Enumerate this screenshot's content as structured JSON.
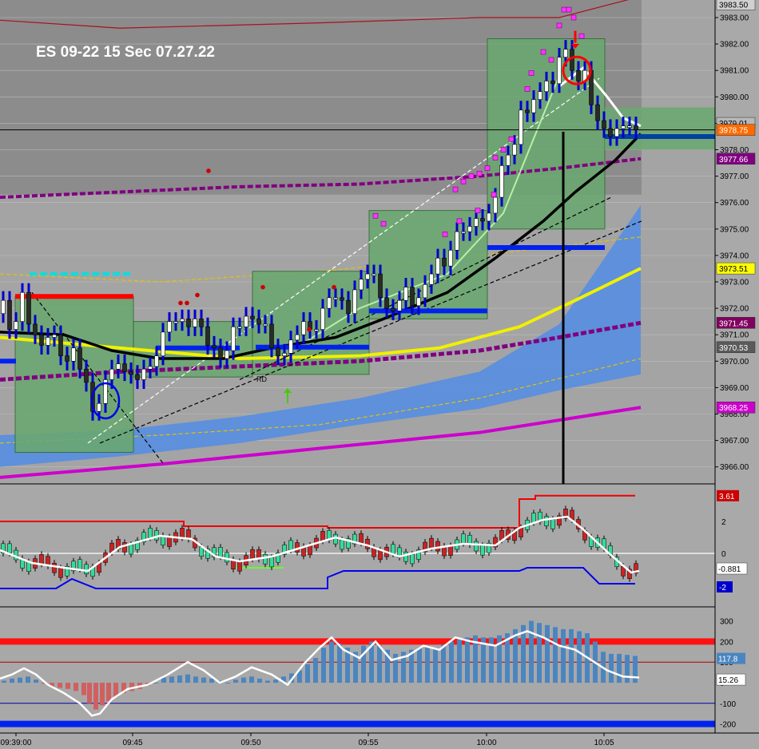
{
  "chart_title": "ES  09-22  15 Sec  07.27.22",
  "annotation_label": "RD",
  "chart_data": [
    {
      "type": "candlestick",
      "title": "ES  09-22  15 Sec  07.27.22",
      "ylim": [
        3965.5,
        3983.7
      ],
      "y_ticks": [
        "3966.00",
        "3967.00",
        "3968.00",
        "3969.00",
        "3970.00",
        "3971.00",
        "3972.00",
        "3973.00",
        "3974.00",
        "3975.00",
        "3976.00",
        "3977.00",
        "3978.00",
        "3979.00",
        "3980.00",
        "3981.00",
        "3982.00",
        "3983.00"
      ],
      "price_tags": [
        {
          "label": "3983.50",
          "value": 3983.5,
          "color": "#d0d0d0",
          "text_color": "#000000"
        },
        {
          "label": "3979.01",
          "value": 3979.01,
          "color": "#b8b8b8",
          "text_color": "#000000"
        },
        {
          "label": "3978.75",
          "value": 3978.75,
          "color": "#ff6a00",
          "text_color": "#ffffff"
        },
        {
          "label": "3977.66",
          "value": 3977.66,
          "color": "#800080",
          "text_color": "#ffffff"
        },
        {
          "label": "3973.51",
          "value": 3973.51,
          "color": "#ffff00",
          "text_color": "#000000"
        },
        {
          "label": "3971.45",
          "value": 3971.45,
          "color": "#800060",
          "text_color": "#ffffff"
        },
        {
          "label": "3970.53",
          "value": 3970.53,
          "color": "#5a5a5a",
          "text_color": "#ffffff"
        },
        {
          "label": "3968.25",
          "value": 3968.25,
          "color": "#cc00cc",
          "text_color": "#ffffff"
        }
      ],
      "close_path": [
        [
          0,
          3971.8
        ],
        [
          8,
          3972.3
        ],
        [
          16,
          3971.2
        ],
        [
          24,
          3971.5
        ],
        [
          32,
          3972.6
        ],
        [
          40,
          3971.4
        ],
        [
          48,
          3971.0
        ],
        [
          56,
          3970.6
        ],
        [
          64,
          3970.9
        ],
        [
          72,
          3971.0
        ],
        [
          80,
          3970.2
        ],
        [
          88,
          3970.0
        ],
        [
          96,
          3970.5
        ],
        [
          104,
          3969.7
        ],
        [
          112,
          3969.2
        ],
        [
          120,
          3968.1
        ],
        [
          128,
          3968.4
        ],
        [
          136,
          3969.3
        ],
        [
          144,
          3969.7
        ],
        [
          152,
          3969.9
        ],
        [
          160,
          3969.6
        ],
        [
          168,
          3969.5
        ],
        [
          176,
          3969.3
        ],
        [
          184,
          3969.7
        ],
        [
          192,
          3969.8
        ],
        [
          200,
          3970.2
        ],
        [
          208,
          3971.1
        ],
        [
          216,
          3971.5
        ],
        [
          224,
          3971.5
        ],
        [
          232,
          3971.6
        ],
        [
          240,
          3971.3
        ],
        [
          248,
          3971.6
        ],
        [
          256,
          3971.3
        ],
        [
          264,
          3970.6
        ],
        [
          272,
          3970.5
        ],
        [
          280,
          3970.1
        ],
        [
          288,
          3970.4
        ],
        [
          296,
          3971.3
        ],
        [
          304,
          3971.3
        ],
        [
          312,
          3971.7
        ],
        [
          320,
          3971.6
        ],
        [
          328,
          3971.4
        ],
        [
          336,
          3971.4
        ],
        [
          344,
          3970.5
        ],
        [
          352,
          3970.2
        ],
        [
          360,
          3970.3
        ],
        [
          368,
          3970.8
        ],
        [
          376,
          3971.0
        ],
        [
          384,
          3971.5
        ],
        [
          392,
          3971.2
        ],
        [
          400,
          3971.2
        ],
        [
          408,
          3972.0
        ],
        [
          416,
          3972.4
        ],
        [
          424,
          3972.4
        ],
        [
          432,
          3972.3
        ],
        [
          440,
          3971.8
        ],
        [
          448,
          3972.7
        ],
        [
          456,
          3973.1
        ],
        [
          464,
          3973.3
        ],
        [
          472,
          3973.3
        ],
        [
          480,
          3972.4
        ],
        [
          488,
          3972.0
        ],
        [
          496,
          3971.9
        ],
        [
          504,
          3972.3
        ],
        [
          512,
          3972.8
        ],
        [
          520,
          3972.1
        ],
        [
          528,
          3972.4
        ],
        [
          536,
          3972.9
        ],
        [
          544,
          3973.3
        ],
        [
          552,
          3973.9
        ],
        [
          560,
          3973.6
        ],
        [
          568,
          3974.2
        ],
        [
          576,
          3974.9
        ],
        [
          584,
          3974.9
        ],
        [
          592,
          3975.1
        ],
        [
          600,
          3975.4
        ],
        [
          608,
          3975.3
        ],
        [
          616,
          3975.6
        ],
        [
          624,
          3976.2
        ],
        [
          632,
          3977.4
        ],
        [
          640,
          3977.8
        ],
        [
          648,
          3978.2
        ],
        [
          656,
          3979.5
        ],
        [
          664,
          3979.4
        ],
        [
          672,
          3979.9
        ],
        [
          680,
          3980.2
        ],
        [
          688,
          3980.6
        ],
        [
          696,
          3980.5
        ],
        [
          704,
          3981.5
        ],
        [
          712,
          3981.8
        ],
        [
          720,
          3981.0
        ],
        [
          728,
          3980.6
        ],
        [
          736,
          3981.0
        ],
        [
          744,
          3979.7
        ],
        [
          752,
          3979.1
        ],
        [
          760,
          3978.8
        ],
        [
          768,
          3978.5
        ],
        [
          776,
          3978.8
        ],
        [
          784,
          3978.9
        ],
        [
          792,
          3978.9
        ],
        [
          800,
          3978.75
        ]
      ],
      "green_zones": [
        {
          "x0": 19,
          "x1": 167,
          "top": 3972.45,
          "bottom": 3966.55
        },
        {
          "x0": 167,
          "x1": 316,
          "top": 3971.5,
          "bottom": 3969.4
        },
        {
          "x0": 316,
          "x1": 462,
          "top": 3973.4,
          "bottom": 3969.5
        },
        {
          "x0": 462,
          "x1": 610,
          "top": 3975.7,
          "bottom": 3971.6
        },
        {
          "x0": 610,
          "x1": 757,
          "top": 3982.2,
          "bottom": 3975.0
        }
      ],
      "time_labels": [
        "09:39:00",
        "09:45",
        "09:50",
        "09:55",
        "10:00",
        "10:05"
      ]
    },
    {
      "type": "line",
      "name_values": [
        "3.61",
        "2",
        "0",
        "-2",
        "-0.881"
      ],
      "ylim": [
        -2.7,
        4.5
      ],
      "series": [
        {
          "points": [
            [
              0,
              0.2
            ],
            [
              40,
              -0.6
            ],
            [
              80,
              -0.9
            ],
            [
              110,
              -1.1
            ],
            [
              150,
              0.4
            ],
            [
              200,
              1.1
            ],
            [
              240,
              0.9
            ],
            [
              270,
              -0.2
            ],
            [
              300,
              -0.5
            ],
            [
              340,
              -0.2
            ],
            [
              380,
              0.4
            ],
            [
              420,
              1.0
            ],
            [
              460,
              0.5
            ],
            [
              500,
              -0.2
            ],
            [
              540,
              0.3
            ],
            [
              580,
              0.6
            ],
            [
              620,
              0.5
            ],
            [
              650,
              1.6
            ],
            [
              680,
              2.1
            ],
            [
              710,
              2.3
            ],
            [
              730,
              1.5
            ],
            [
              760,
              0.1
            ],
            [
              790,
              -1.2
            ],
            [
              800,
              -1.1
            ]
          ]
        }
      ],
      "upper_band": [
        [
          0,
          2.0
        ],
        [
          230,
          2.0
        ],
        [
          230,
          1.7
        ],
        [
          410,
          1.7
        ],
        [
          410,
          1.6
        ],
        [
          650,
          1.6
        ],
        [
          650,
          3.4
        ],
        [
          670,
          3.4
        ],
        [
          670,
          3.61
        ],
        [
          795,
          3.61
        ]
      ],
      "lower_band": [
        [
          0,
          -2.2
        ],
        [
          70,
          -2.2
        ],
        [
          90,
          -1.6
        ],
        [
          120,
          -2.2
        ],
        [
          410,
          -2.2
        ],
        [
          410,
          -1.5
        ],
        [
          430,
          -1.1
        ],
        [
          650,
          -1.1
        ],
        [
          660,
          -0.9
        ],
        [
          730,
          -0.9
        ],
        [
          750,
          -1.9
        ],
        [
          795,
          -1.9
        ]
      ]
    },
    {
      "type": "bar",
      "ylim": [
        -225,
        335
      ],
      "y_ticks": [
        "300",
        "200",
        "100",
        "0",
        "-100",
        "-200"
      ],
      "tags": [
        {
          "label": "117.8",
          "value": 117.8
        },
        {
          "label": "15.26",
          "value": 15.26
        }
      ],
      "reference_lines": [
        200,
        100,
        -100,
        -200
      ],
      "histogram": [
        [
          5,
          10
        ],
        [
          15,
          20
        ],
        [
          25,
          25
        ],
        [
          35,
          30
        ],
        [
          45,
          15
        ],
        [
          55,
          -5
        ],
        [
          65,
          -20
        ],
        [
          75,
          -25
        ],
        [
          85,
          -30
        ],
        [
          95,
          -40
        ],
        [
          105,
          -60
        ],
        [
          112,
          -100
        ],
        [
          120,
          -130
        ],
        [
          128,
          -110
        ],
        [
          136,
          -90
        ],
        [
          145,
          -70
        ],
        [
          155,
          -50
        ],
        [
          165,
          -40
        ],
        [
          175,
          -30
        ],
        [
          185,
          -15
        ],
        [
          195,
          0
        ],
        [
          205,
          25
        ],
        [
          215,
          30
        ],
        [
          225,
          35
        ],
        [
          235,
          40
        ],
        [
          245,
          30
        ],
        [
          255,
          25
        ],
        [
          265,
          20
        ],
        [
          275,
          10
        ],
        [
          285,
          0
        ],
        [
          295,
          15
        ],
        [
          305,
          25
        ],
        [
          315,
          30
        ],
        [
          325,
          20
        ],
        [
          335,
          10
        ],
        [
          345,
          15
        ],
        [
          355,
          30
        ],
        [
          365,
          45
        ],
        [
          375,
          60
        ],
        [
          385,
          90
        ],
        [
          395,
          120
        ],
        [
          405,
          170
        ],
        [
          415,
          200
        ],
        [
          425,
          190
        ],
        [
          435,
          170
        ],
        [
          445,
          150
        ],
        [
          455,
          180
        ],
        [
          465,
          200
        ],
        [
          475,
          180
        ],
        [
          485,
          160
        ],
        [
          495,
          140
        ],
        [
          505,
          150
        ],
        [
          515,
          160
        ],
        [
          525,
          170
        ],
        [
          535,
          180
        ],
        [
          545,
          170
        ],
        [
          555,
          185
        ],
        [
          565,
          200
        ],
        [
          575,
          210
        ],
        [
          585,
          220
        ],
        [
          595,
          230
        ],
        [
          605,
          220
        ],
        [
          615,
          220
        ],
        [
          625,
          230
        ],
        [
          635,
          240
        ],
        [
          645,
          260
        ],
        [
          655,
          280
        ],
        [
          665,
          300
        ],
        [
          675,
          290
        ],
        [
          685,
          280
        ],
        [
          695,
          270
        ],
        [
          705,
          260
        ],
        [
          715,
          260
        ],
        [
          725,
          250
        ],
        [
          735,
          240
        ],
        [
          745,
          200
        ],
        [
          755,
          150
        ],
        [
          765,
          140
        ],
        [
          775,
          140
        ],
        [
          785,
          135
        ],
        [
          795,
          130
        ]
      ],
      "line": [
        [
          0,
          20
        ],
        [
          15,
          40
        ],
        [
          30,
          70
        ],
        [
          45,
          40
        ],
        [
          60,
          -10
        ],
        [
          80,
          -50
        ],
        [
          100,
          -100
        ],
        [
          115,
          -160
        ],
        [
          125,
          -150
        ],
        [
          140,
          -80
        ],
        [
          160,
          -30
        ],
        [
          185,
          -10
        ],
        [
          210,
          40
        ],
        [
          235,
          100
        ],
        [
          255,
          60
        ],
        [
          275,
          0
        ],
        [
          295,
          30
        ],
        [
          315,
          75
        ],
        [
          340,
          40
        ],
        [
          360,
          -10
        ],
        [
          380,
          90
        ],
        [
          400,
          170
        ],
        [
          415,
          220
        ],
        [
          430,
          160
        ],
        [
          450,
          120
        ],
        [
          470,
          200
        ],
        [
          490,
          110
        ],
        [
          510,
          130
        ],
        [
          530,
          180
        ],
        [
          550,
          160
        ],
        [
          570,
          220
        ],
        [
          590,
          200
        ],
        [
          620,
          180
        ],
        [
          645,
          230
        ],
        [
          660,
          250
        ],
        [
          680,
          220
        ],
        [
          700,
          180
        ],
        [
          720,
          160
        ],
        [
          740,
          110
        ],
        [
          760,
          60
        ],
        [
          780,
          30
        ],
        [
          800,
          25
        ]
      ]
    }
  ]
}
